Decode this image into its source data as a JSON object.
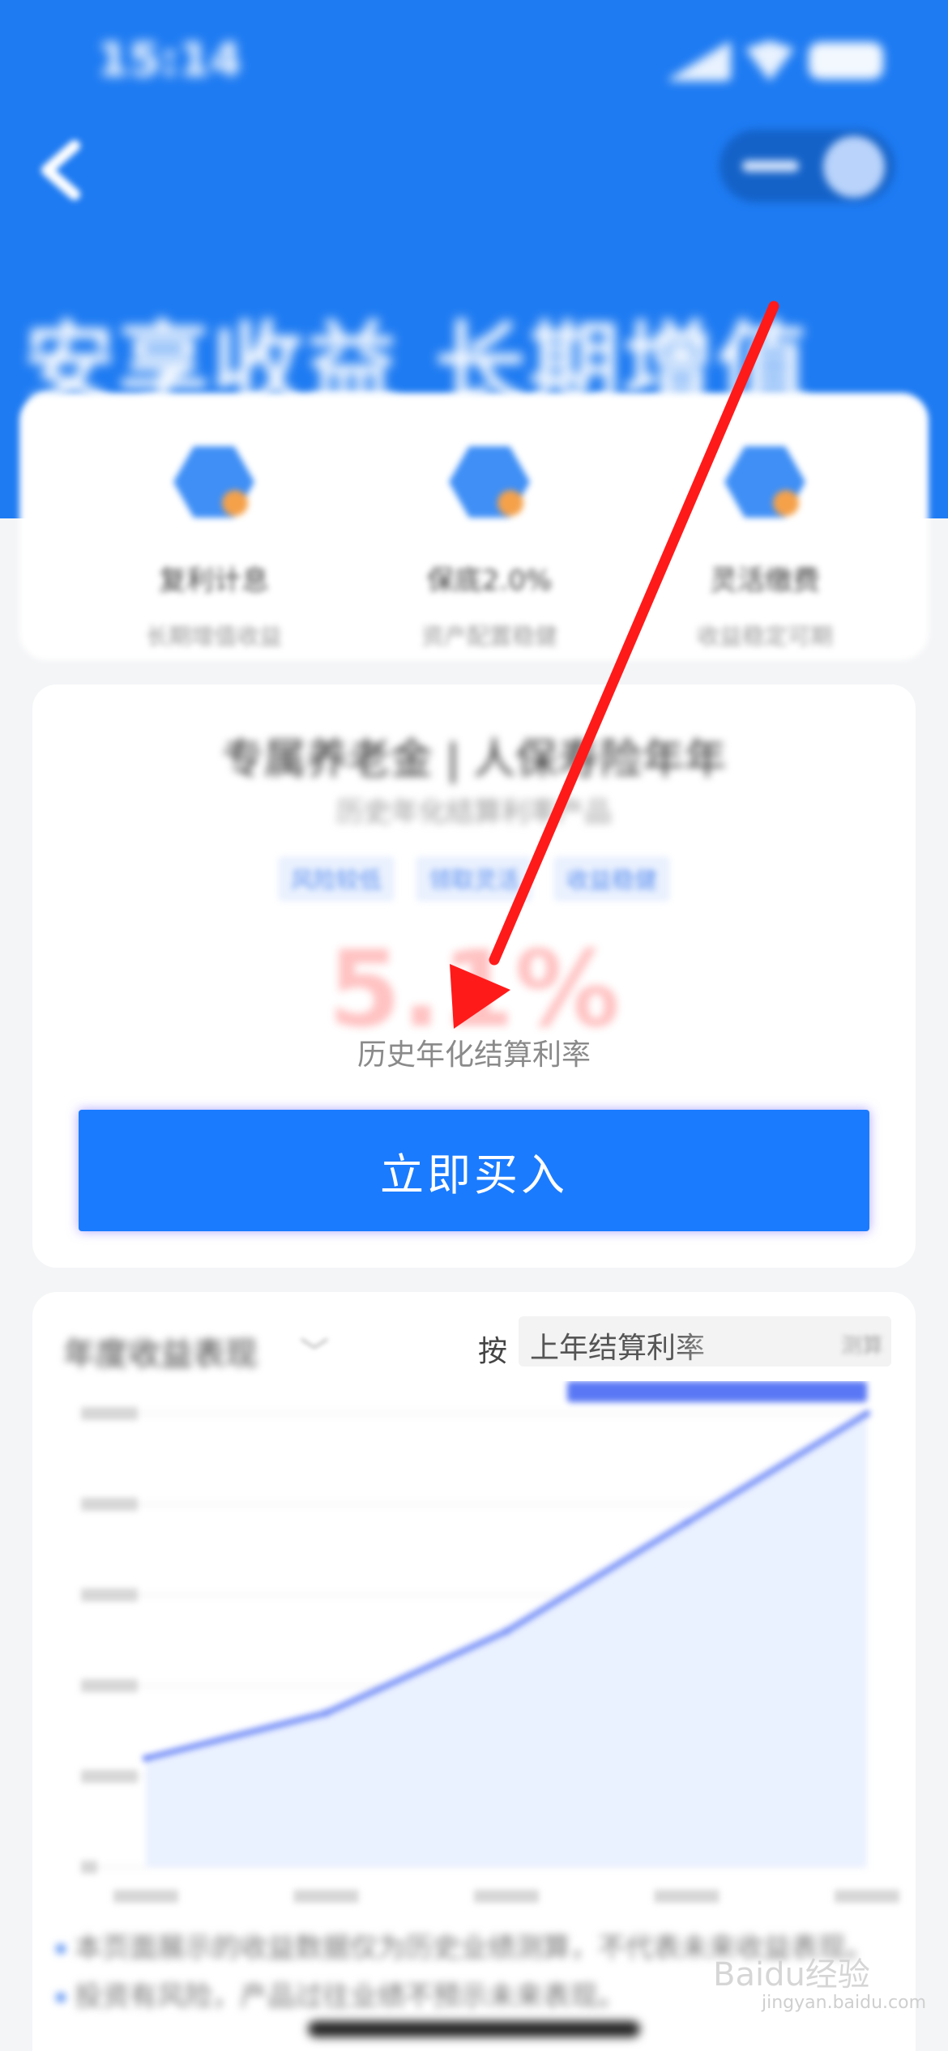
{
  "status_bar": {
    "time": "15:14"
  },
  "header": {
    "slogan": "安享收益 长期增值"
  },
  "features": [
    {
      "title": "复利计息",
      "subtitle": "长期增值收益"
    },
    {
      "title": "保底2.0%",
      "subtitle": "资产配置稳健"
    },
    {
      "title": "灵活缴费",
      "subtitle": "收益稳定可期"
    }
  ],
  "product": {
    "name": "专属养老金 | 人保寿险年年",
    "subtitle": "历史年化结算利率产品",
    "tags": [
      "风险较低",
      "领取灵活",
      "收益稳健"
    ],
    "rate": "5.1%",
    "rate_label": "历史年化结算利率",
    "buy_label": "立即买入"
  },
  "chart_section": {
    "title": "年度收益表现",
    "by_label": "按",
    "selector_value": "上年结算利率",
    "selector_tail": "测算"
  },
  "chart_data": {
    "type": "area",
    "title": "",
    "xlabel": "",
    "ylabel": "",
    "x": [
      "",
      "",
      "",
      "",
      ""
    ],
    "series": [
      {
        "values": [
          6,
          8.5,
          13,
          19,
          25
        ]
      }
    ],
    "ylim": [
      0,
      25
    ],
    "grid": true,
    "color": "#5a78f5"
  },
  "notes": [
    "本页面展示的收益数据仅为历史业绩测算，不代表未来收益表现。",
    "投资有风险，产品过往业绩不预示未来表现。"
  ],
  "watermark": {
    "brand": "Baidu经验",
    "url": "jingyan.baidu.com"
  },
  "colors": {
    "primary": "#1a7bff",
    "header": "#1e7bf2",
    "arrow": "#ff1a1a"
  }
}
